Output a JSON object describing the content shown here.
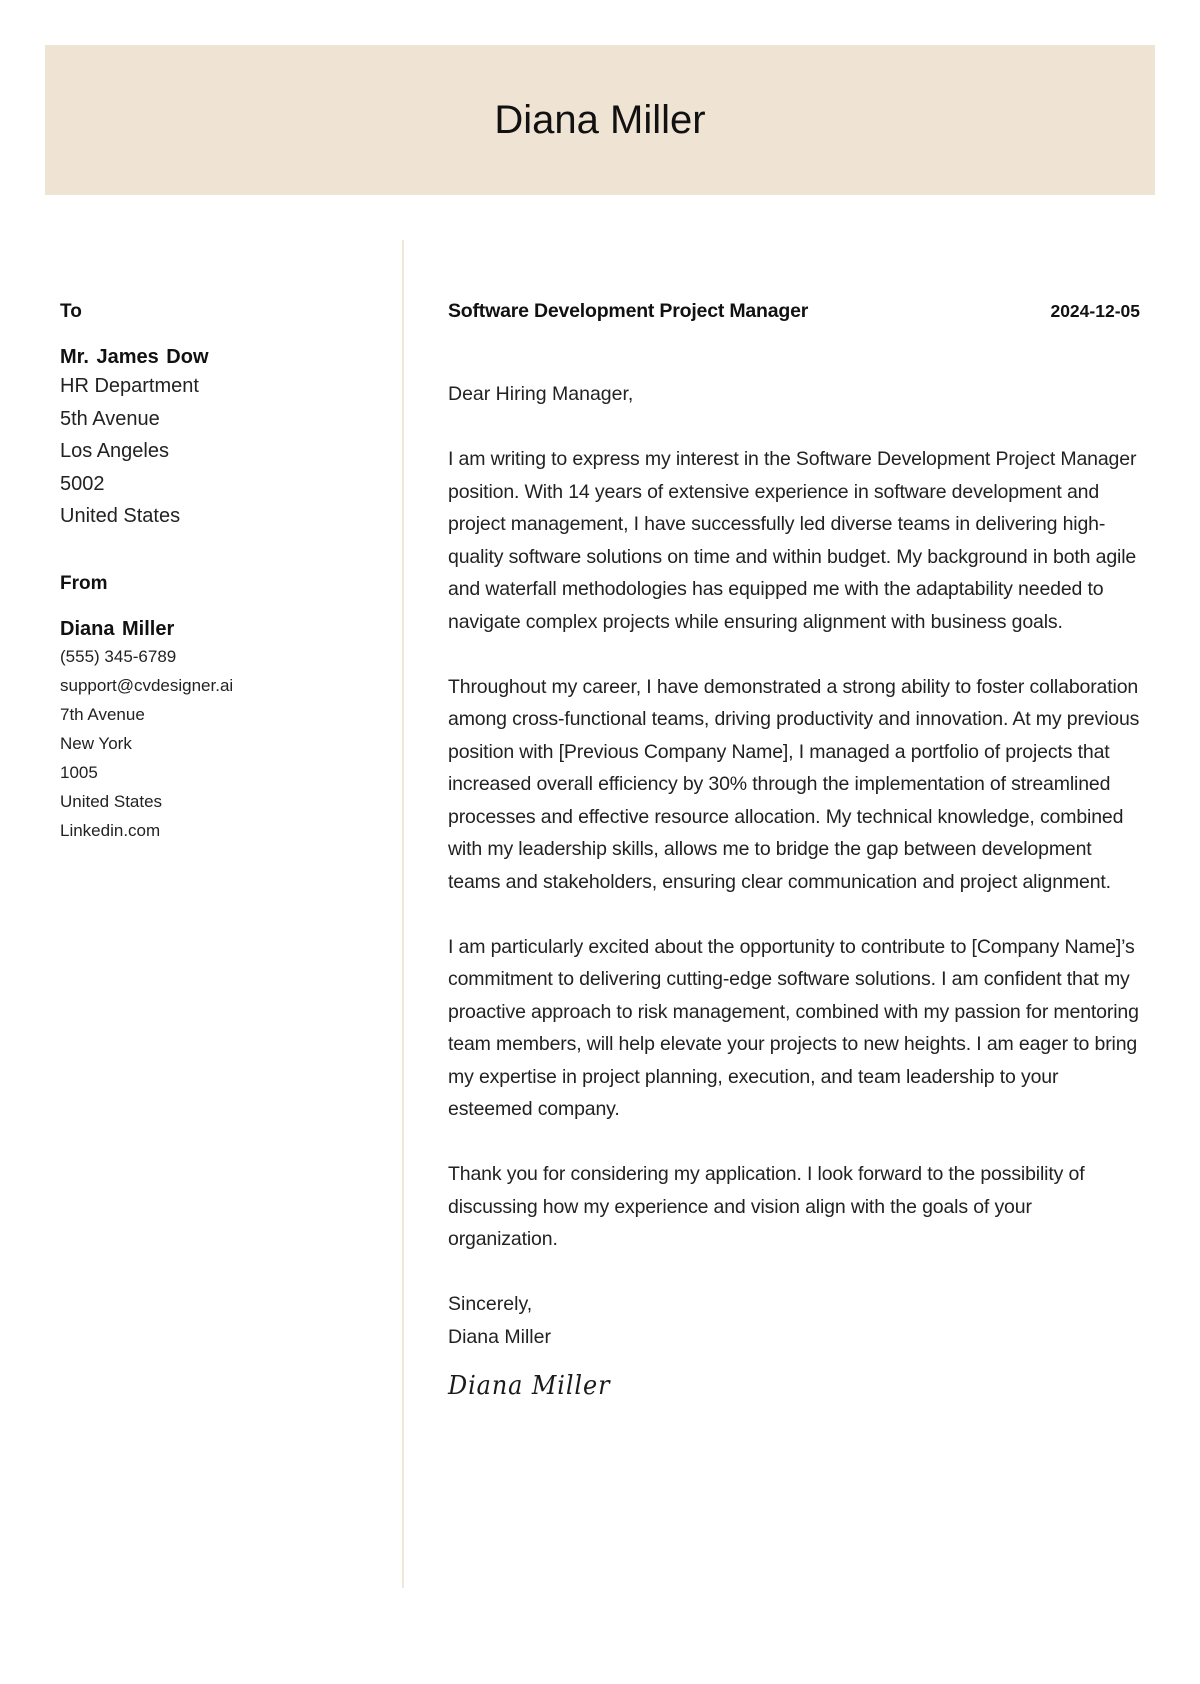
{
  "header": {
    "name": "Diana Miller",
    "background_color": "#efe3d4"
  },
  "recipient": {
    "label": "To",
    "name": "Mr. James Dow",
    "lines": [
      "HR Department",
      "5th Avenue",
      "Los Angeles",
      "5002",
      "United States"
    ]
  },
  "sender": {
    "label": "From",
    "name": "Diana Miller",
    "phone": "(555) 345-6789",
    "email": "support@cvdesigner.ai",
    "street": "7th Avenue",
    "city": "New York",
    "postal_code": "1005",
    "country": "United States",
    "website": "Linkedin.com"
  },
  "letter": {
    "job_title": "Software Development Project Manager",
    "date": "2024-12-05",
    "salutation": "Dear Hiring Manager,",
    "paragraphs": [
      "I am writing to express my interest in the Software Development Project Manager position. With 14 years of extensive experience in software development and project management, I have successfully led diverse teams in delivering high-quality software solutions on time and within budget. My background in both agile and waterfall methodologies has equipped me with the adaptability needed to navigate complex projects while ensuring alignment with business goals.",
      "Throughout my career, I have demonstrated a strong ability to foster collaboration among cross-functional teams, driving productivity and innovation. At my previous position with [Previous Company Name], I managed a portfolio of projects that increased overall efficiency by 30% through the implementation of streamlined processes and effective resource allocation. My technical knowledge, combined with my leadership skills, allows me to bridge the gap between development teams and stakeholders, ensuring clear communication and project alignment.",
      "I am particularly excited about the opportunity to contribute to [Company Name]’s commitment to delivering cutting-edge software solutions. I am confident that my proactive approach to risk management, combined with my passion for mentoring team members, will help elevate your projects to new heights. I am eager to bring my expertise in project planning, execution, and team leadership to your esteemed company.",
      "Thank you for considering my application. I look forward to the possibility of discussing how my experience and vision align with the goals of your organization."
    ],
    "closing": "Sincerely,",
    "closing_name": "Diana Miller",
    "signature": "Diana Miller"
  }
}
